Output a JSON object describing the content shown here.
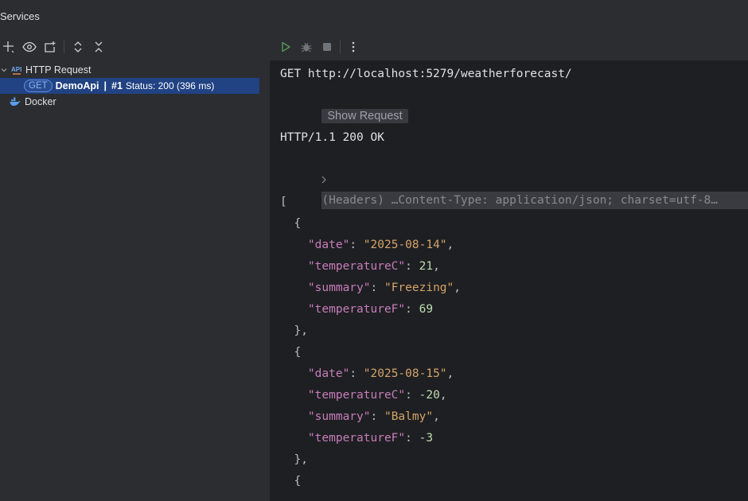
{
  "window": {
    "title": "Services"
  },
  "left_toolbar": {
    "icons": [
      "add-icon",
      "eye-icon",
      "new-tab-icon",
      "expand-icon",
      "collapse-icon"
    ]
  },
  "tree": {
    "http_request": {
      "label": "HTTP Request"
    },
    "selected": {
      "method": "GET",
      "name": "DemoApi",
      "separator": "|",
      "run": "#1",
      "status": "Status: 200 (396 ms)"
    },
    "docker": {
      "label": "Docker"
    }
  },
  "right_toolbar": {
    "icons": [
      "run-icon",
      "debug-icon",
      "stop-icon",
      "more-icon"
    ]
  },
  "response": {
    "request_line": "GET http://localhost:5279/weatherforecast/",
    "show_request": "Show Request",
    "status_line": "HTTP/1.1 200 OK",
    "headers": "(Headers) …Content-Type: application/json; charset=utf-8…",
    "body": [
      {
        "indent": 0,
        "text": "["
      },
      {
        "indent": 1,
        "text": "{"
      },
      {
        "indent": 2,
        "key": "\"date\"",
        "value": "\"2025-08-14\"",
        "type": "string",
        "comma": ","
      },
      {
        "indent": 2,
        "key": "\"temperatureC\"",
        "value": "21",
        "type": "number",
        "comma": ","
      },
      {
        "indent": 2,
        "key": "\"summary\"",
        "value": "\"Freezing\"",
        "type": "string",
        "comma": ","
      },
      {
        "indent": 2,
        "key": "\"temperatureF\"",
        "value": "69",
        "type": "number",
        "comma": ""
      },
      {
        "indent": 1,
        "text": "},"
      },
      {
        "indent": 1,
        "text": "{"
      },
      {
        "indent": 2,
        "key": "\"date\"",
        "value": "\"2025-08-15\"",
        "type": "string",
        "comma": ","
      },
      {
        "indent": 2,
        "key": "\"temperatureC\"",
        "value": "-20",
        "type": "number",
        "comma": ","
      },
      {
        "indent": 2,
        "key": "\"summary\"",
        "value": "\"Balmy\"",
        "type": "string",
        "comma": ","
      },
      {
        "indent": 2,
        "key": "\"temperatureF\"",
        "value": "-3",
        "type": "number",
        "comma": ""
      },
      {
        "indent": 1,
        "text": "},"
      },
      {
        "indent": 1,
        "text": "{"
      }
    ]
  },
  "colors": {
    "key": "#c77dbb",
    "string": "#d4a46a",
    "number": "#bcdcb0",
    "punct": "#bcbec4",
    "selection": "#214283"
  }
}
